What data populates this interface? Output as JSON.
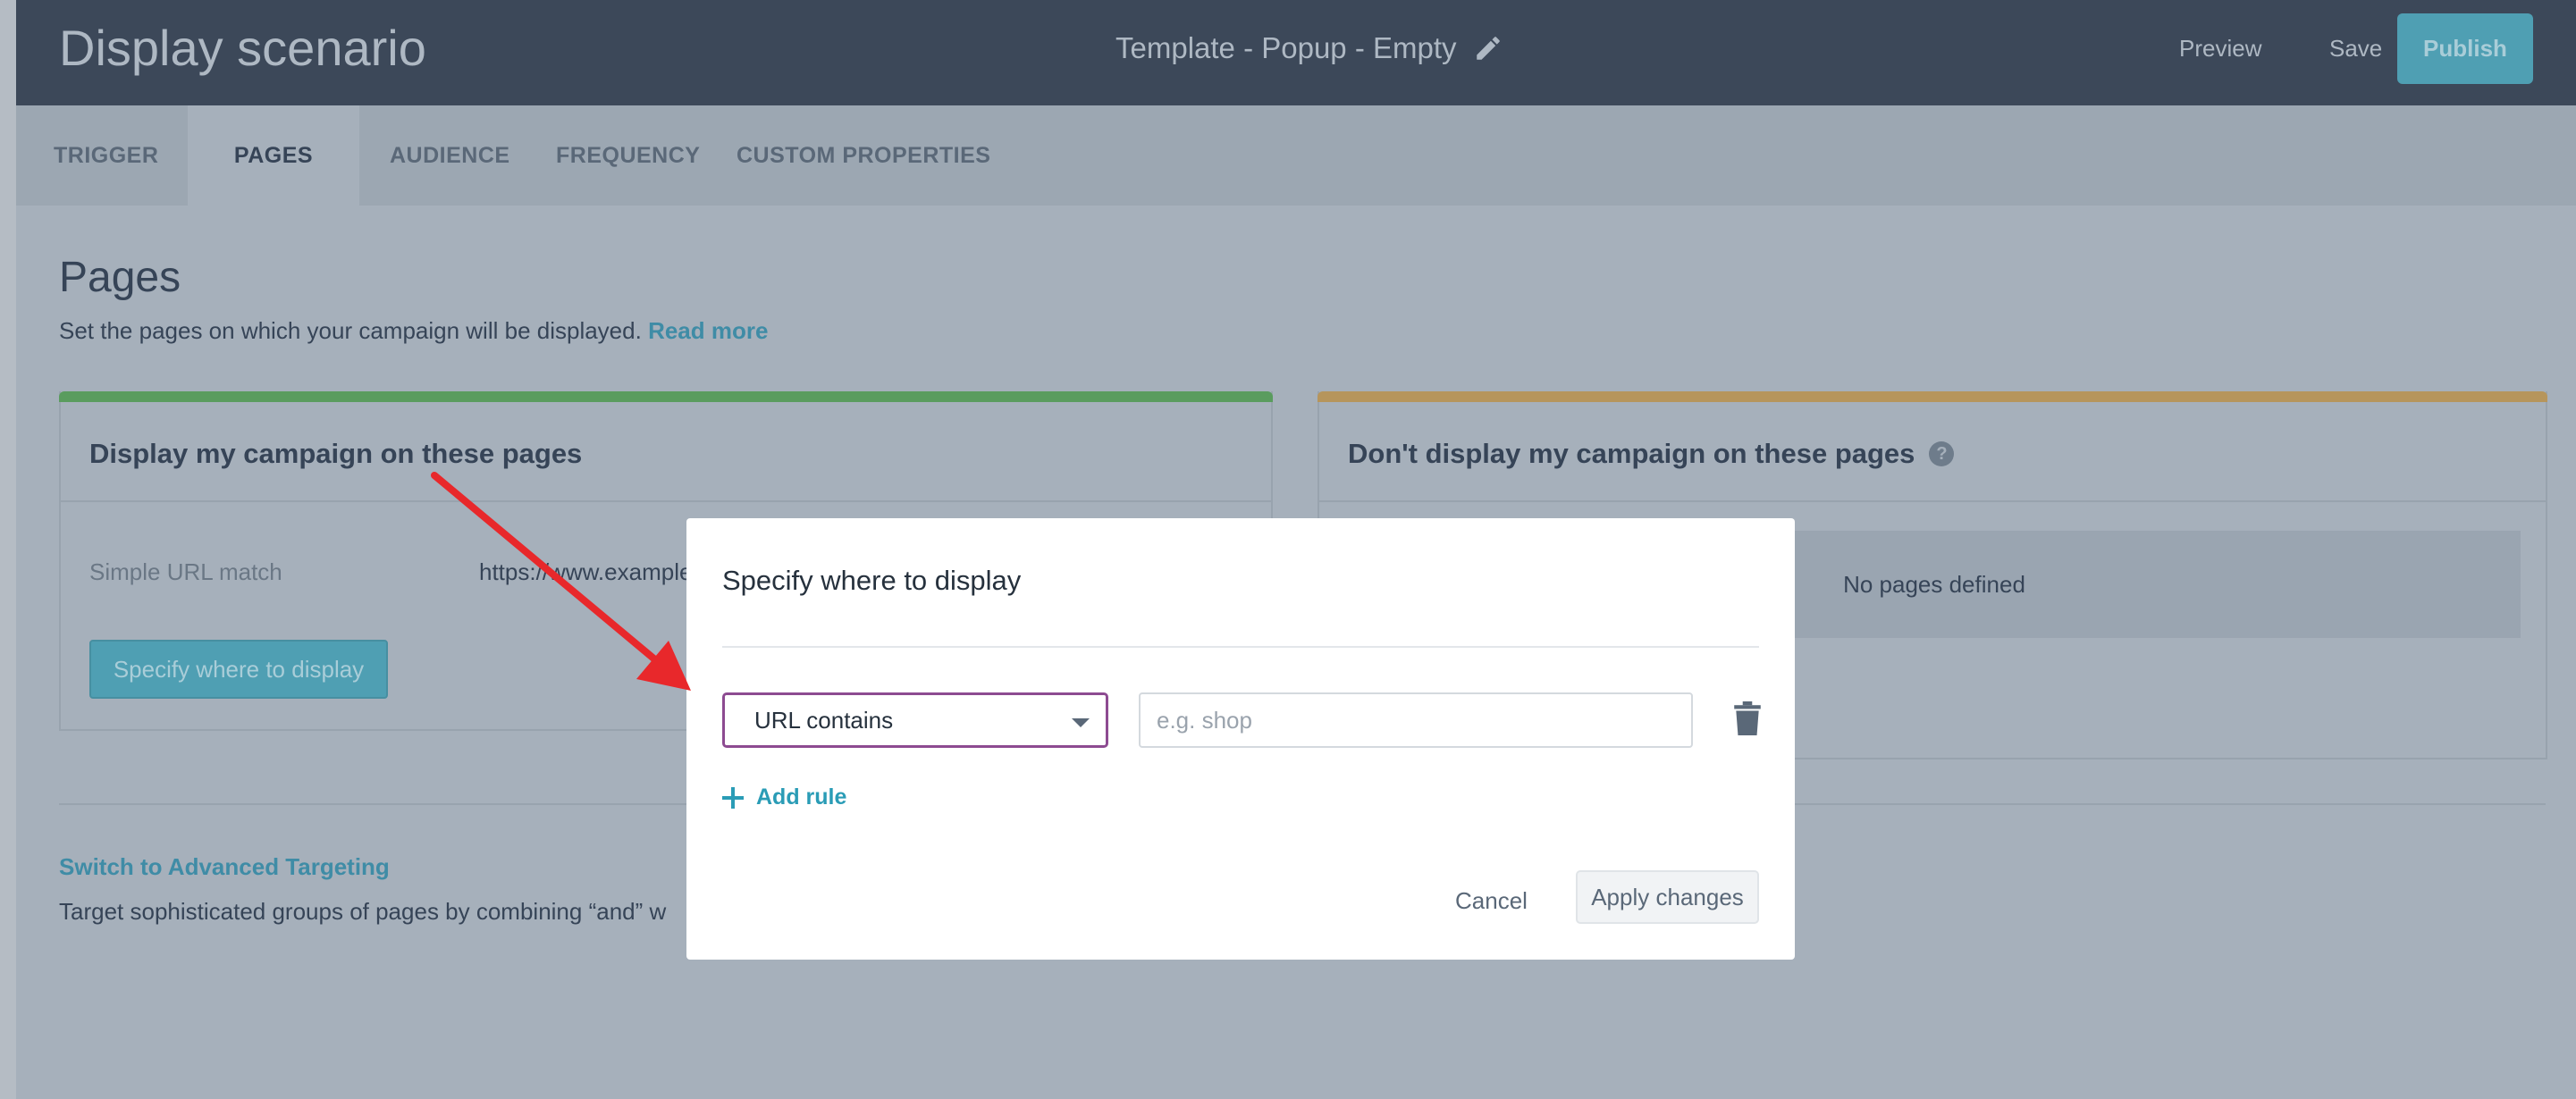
{
  "header": {
    "title": "Display scenario",
    "template_name": "Template - Popup - Empty",
    "preview_label": "Preview",
    "save_label": "Save",
    "publish_label": "Publish"
  },
  "tabs": [
    {
      "label": "TRIGGER"
    },
    {
      "label": "PAGES"
    },
    {
      "label": "AUDIENCE"
    },
    {
      "label": "FREQUENCY"
    },
    {
      "label": "CUSTOM PROPERTIES"
    }
  ],
  "active_tab": "PAGES",
  "page": {
    "title": "Pages",
    "description": "Set the pages on which your campaign will be displayed.",
    "read_more": "Read more"
  },
  "include_panel": {
    "title": "Display my campaign on these pages",
    "accent_color": "#5a9c5e",
    "rule_label": "Simple URL match",
    "rule_value": "https://www.example.c",
    "specify_button": "Specify where to display"
  },
  "exclude_panel": {
    "title": "Don't display my campaign on these pages",
    "accent_color": "#b6955c",
    "empty_text": "No pages defined"
  },
  "advanced": {
    "link": "Switch to Advanced Targeting",
    "description": "Target sophisticated groups of pages by combining “and” w"
  },
  "modal": {
    "title": "Specify where to display",
    "select_value": "URL contains",
    "input_placeholder": "e.g. shop",
    "input_value": "",
    "add_rule": "Add rule",
    "cancel": "Cancel",
    "apply": "Apply changes"
  }
}
